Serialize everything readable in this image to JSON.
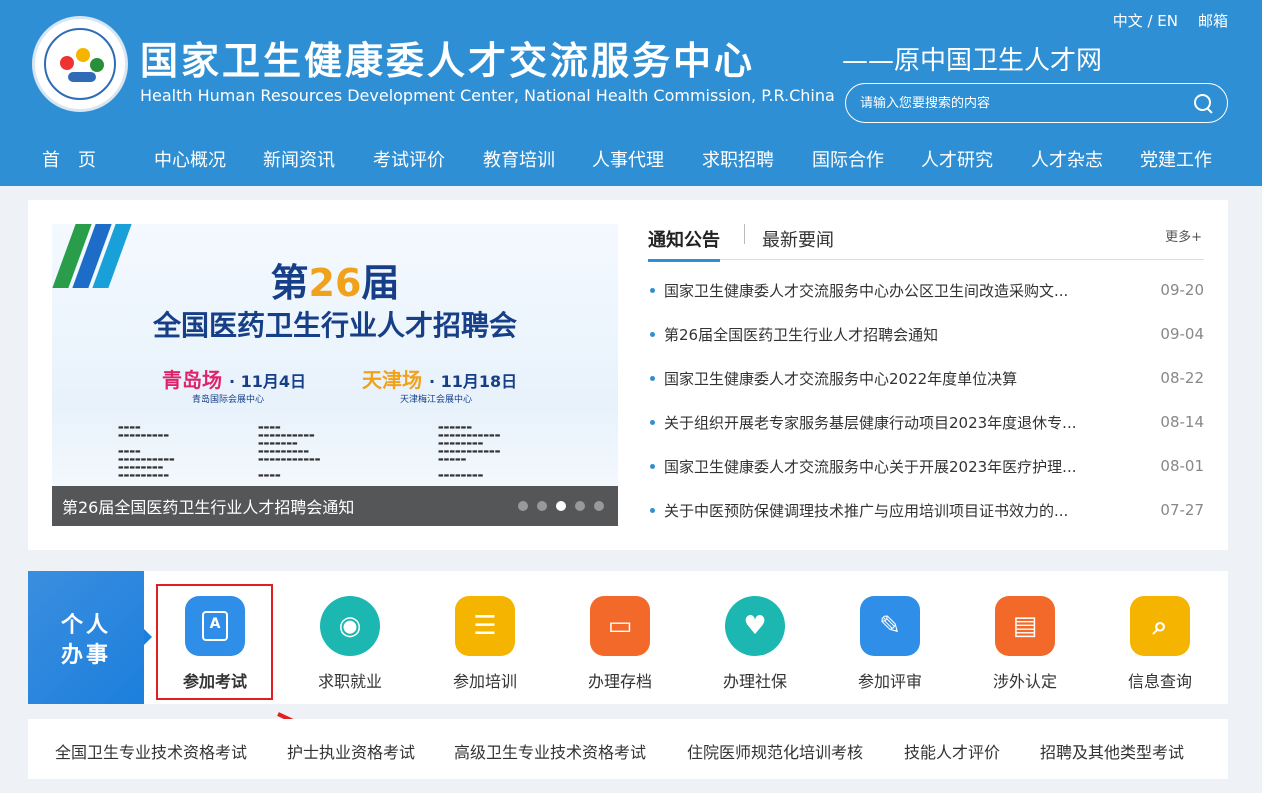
{
  "header": {
    "title": "国家卫生健康委人才交流服务中心",
    "subtitle": "Health Human Resources Development Center, National Health Commission, P.R.China",
    "slogan": "——原中国卫生人才网",
    "lang_label": "中文 / EN",
    "mail_label": "邮箱",
    "search_placeholder": "请输入您要搜索的内容"
  },
  "nav": [
    "首　页",
    "中心概况",
    "新闻资讯",
    "考试评价",
    "教育培训",
    "人事代理",
    "求职招聘",
    "国际合作",
    "人才研究",
    "人才杂志",
    "党建工作"
  ],
  "banner": {
    "title_prefix": "第",
    "title_number": "26",
    "title_suffix": "届",
    "subtitle": "全国医药卫生行业人才招聘会",
    "city1_name": "青岛场",
    "city1_date": "· 11月4日",
    "city1_venue": "青岛国际会展中心",
    "city2_name": "天津场",
    "city2_date": "· 11月18日",
    "city2_venue": "天津梅江会展中心",
    "caption": "第26届全国医药卫生行业人才招聘会通知",
    "slide_count": 5,
    "active_slide": 3
  },
  "news": {
    "tab_active": "通知公告",
    "tab_other": "最新要闻",
    "more_label": "更多+",
    "items": [
      {
        "title": "国家卫生健康委人才交流服务中心办公区卫生间改造采购文...",
        "date": "09-20"
      },
      {
        "title": "第26届全国医药卫生行业人才招聘会通知",
        "date": "09-04"
      },
      {
        "title": "国家卫生健康委人才交流服务中心2022年度单位决算",
        "date": "08-22"
      },
      {
        "title": "关于组织开展老专家服务基层健康行动项目2023年度退休专...",
        "date": "08-14"
      },
      {
        "title": "国家卫生健康委人才交流服务中心关于开展2023年医疗护理...",
        "date": "08-01"
      },
      {
        "title": "关于中医预防保健调理技术推广与应用培训项目证书效力的...",
        "date": "07-27"
      }
    ]
  },
  "services": {
    "label_line1": "个人",
    "label_line2": "办事",
    "items": [
      {
        "label": "参加考试",
        "icon": "exam-icon",
        "color": "#2f8fe8"
      },
      {
        "label": "求职就业",
        "icon": "job-icon",
        "color": "#1bb7b0"
      },
      {
        "label": "参加培训",
        "icon": "training-icon",
        "color": "#f5b400"
      },
      {
        "label": "办理存档",
        "icon": "archive-icon",
        "color": "#f2692a"
      },
      {
        "label": "办理社保",
        "icon": "social-security-icon",
        "color": "#1bb7b0"
      },
      {
        "label": "参加评审",
        "icon": "review-icon",
        "color": "#2f8fe8"
      },
      {
        "label": "涉外认定",
        "icon": "foreign-cert-icon",
        "color": "#f2692a"
      },
      {
        "label": "信息查询",
        "icon": "info-query-icon",
        "color": "#f5b400"
      }
    ]
  },
  "sublinks": [
    "全国卫生专业技术资格考试",
    "护士执业资格考试",
    "高级卫生专业技术资格考试",
    "住院医师规范化培训考核",
    "技能人才评价",
    "招聘及其他类型考试"
  ]
}
